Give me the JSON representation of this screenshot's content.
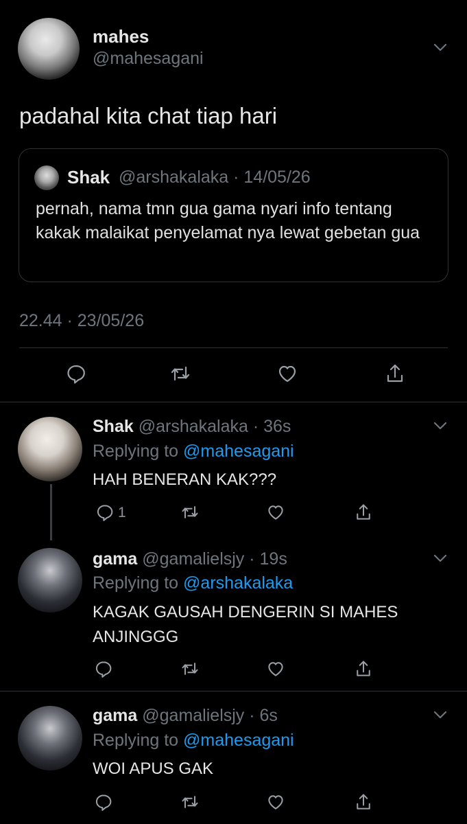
{
  "main_tweet": {
    "name": "mahes",
    "handle": "@mahesagani",
    "text": "padahal kita chat tiap hari",
    "timestamp": "22.44 · 23/05/26",
    "quote": {
      "name": "Shak",
      "meta": "@arshakalaka · 14/05/26",
      "text": "pernah, nama tmn gua gama nyari info tentang kakak malaikat penyelamat nya lewat gebetan gua"
    }
  },
  "replies": [
    {
      "name": "Shak",
      "meta": "@arshakalaka · 36s",
      "replying_label": "Replying to",
      "replying_to": "@mahesagani",
      "text": "HAH BENERAN KAK???",
      "reply_count": "1"
    },
    {
      "name": "gama",
      "meta": "@gamalielsjy · 19s",
      "replying_label": "Replying to",
      "replying_to": "@arshakalaka",
      "text": "KAGAK GAUSAH DENGERIN SI MAHES ANJINGGG"
    },
    {
      "name": "gama",
      "meta": "@gamalielsjy · 6s",
      "replying_label": "Replying to",
      "replying_to": "@mahesagani",
      "text": "WOI APUS GAK"
    }
  ],
  "colors": {
    "background": "#000000",
    "text": "#e6e6e6",
    "muted": "#6e767d",
    "link": "#1d9bf0",
    "divider": "#2f3336"
  },
  "icons": [
    "chevron-down-icon",
    "reply-icon",
    "retweet-icon",
    "like-icon",
    "share-icon"
  ]
}
